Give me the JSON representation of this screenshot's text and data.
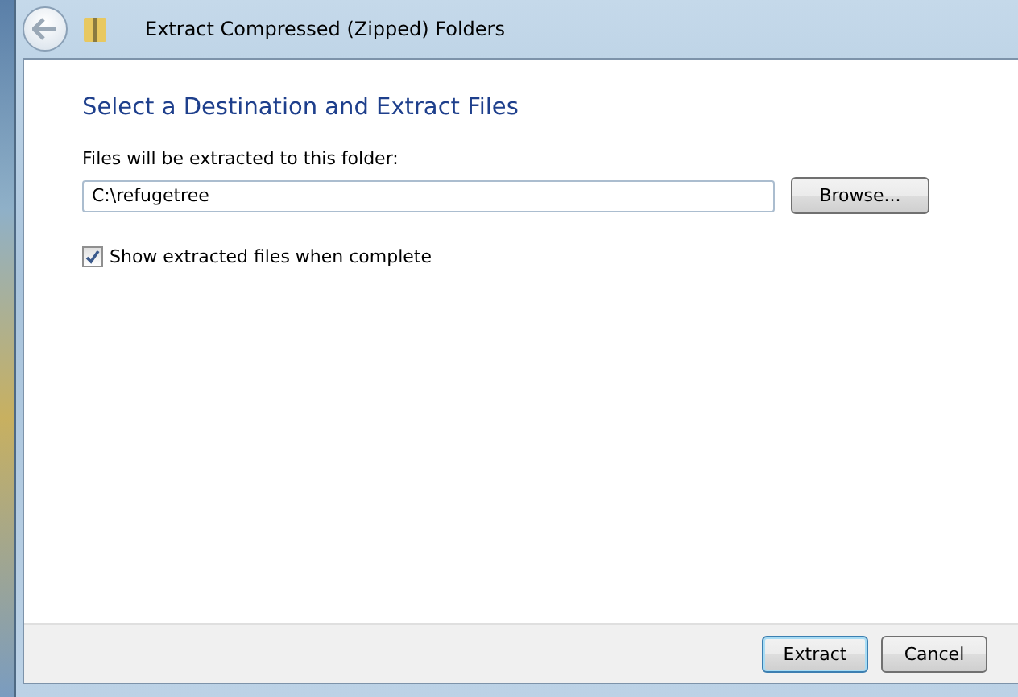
{
  "window": {
    "title": "Extract Compressed (Zipped) Folders"
  },
  "heading": "Select a Destination and Extract Files",
  "destination": {
    "label": "Files will be extracted to this folder:",
    "value": "C:\\refugetree",
    "browse_button": "Browse..."
  },
  "show_files": {
    "label": "Show extracted files when complete",
    "checked": true
  },
  "buttons": [
    {
      "label": "Extract",
      "default": true
    },
    {
      "label": "Cancel",
      "default": false
    }
  ]
}
